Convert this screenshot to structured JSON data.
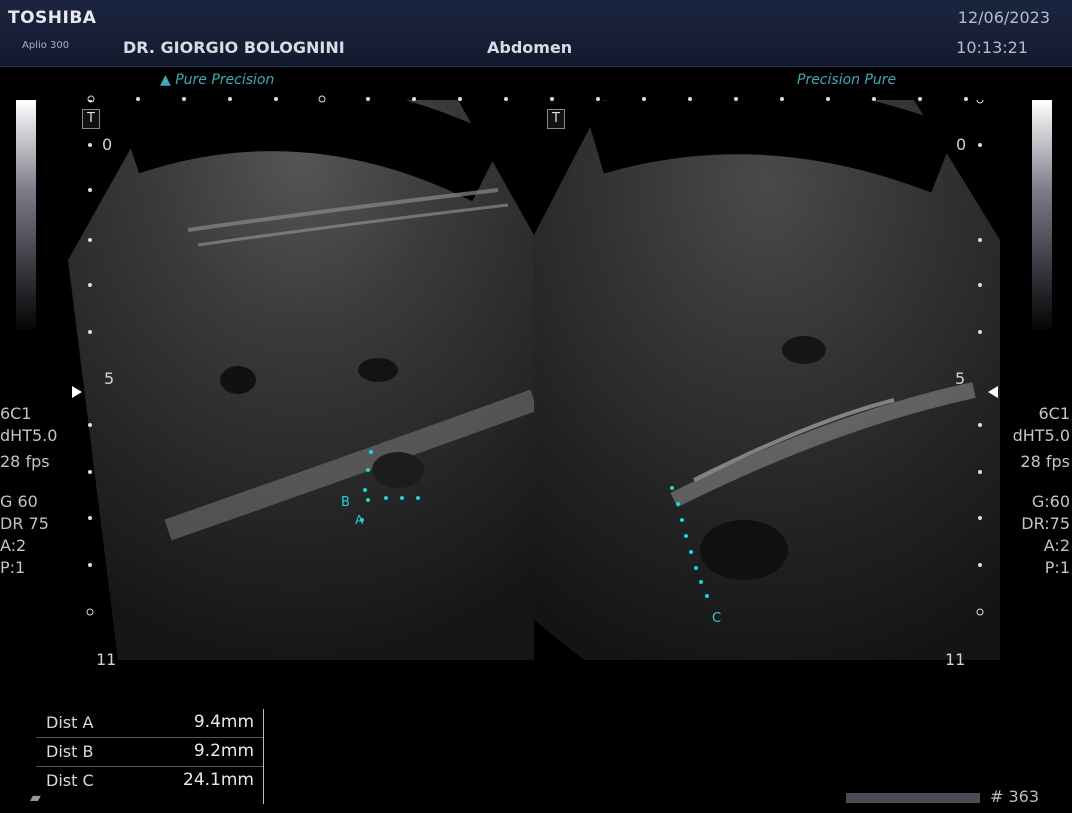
{
  "header": {
    "brand": "TOSHIBA",
    "model": "Aplio 300",
    "doctor": "DR. GIORGIO BOLOGNINI",
    "exam": "Abdomen",
    "date": "12/06/2023",
    "time": "10:13:21"
  },
  "modes": {
    "left": "Pure Precision",
    "right": "Precision Pure"
  },
  "probe_marker": "T",
  "depth_labels": {
    "top": "0",
    "mid": "5",
    "bottom": "11"
  },
  "side_params_left": [
    "6C1",
    "dHT5.0",
    "28 fps",
    "",
    "G 60",
    "DR 75",
    "A:2",
    "P:1"
  ],
  "side_params_right": [
    "6C1",
    "dHT5.0",
    "28 fps",
    "",
    "G:60",
    "DR:75",
    "A:2",
    "P:1"
  ],
  "calipers": {
    "a": "A",
    "b": "B",
    "c": "C"
  },
  "measurements": [
    {
      "label": "Dist A",
      "value": "9.4mm"
    },
    {
      "label": "Dist B",
      "value": "9.2mm"
    },
    {
      "label": "Dist C",
      "value": "24.1mm"
    }
  ],
  "frame_count": "# 363",
  "colors": {
    "caliper": "#28d0d8",
    "mode_text": "#3fa9b5",
    "header_bg": "#1b2540"
  }
}
